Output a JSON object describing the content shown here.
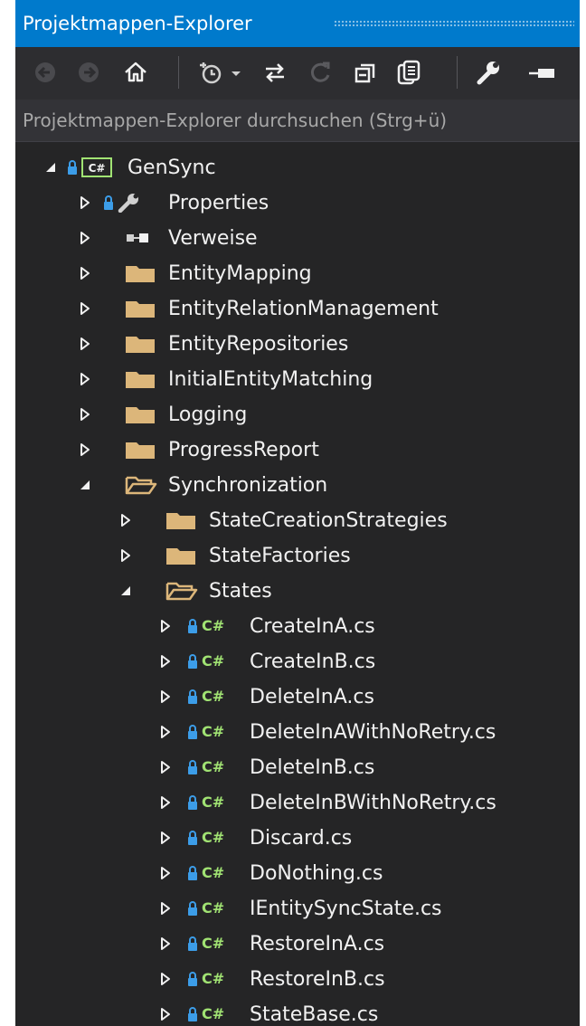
{
  "window": {
    "title": "Projektmappen-Explorer"
  },
  "search": {
    "placeholder": "Projektmappen-Explorer durchsuchen (Strg+ü)"
  },
  "toolbar": {
    "buttons": [
      "back-icon",
      "forward-icon",
      "home-icon",
      "history-icon",
      "dropdown-icon",
      "sync-icon",
      "refresh-icon",
      "collapse-all-icon",
      "show-all-files-icon",
      "properties-icon",
      "pin-icon"
    ]
  },
  "colors": {
    "title_bar": "#007acc",
    "panel": "#252526",
    "folder": "#dcb67a",
    "csharp": "#a1e373",
    "lock": "#3c9de8"
  },
  "tree": [
    {
      "label": "GenSync",
      "level": 0,
      "expanded": true,
      "icon": "csharp-project-icon"
    },
    {
      "label": "Properties",
      "level": 1,
      "expanded": false,
      "icon": "wrench-icon"
    },
    {
      "label": "Verweise",
      "level": 1,
      "expanded": false,
      "icon": "references-icon"
    },
    {
      "label": "EntityMapping",
      "level": 1,
      "expanded": false,
      "icon": "folder-icon"
    },
    {
      "label": "EntityRelationManagement",
      "level": 1,
      "expanded": false,
      "icon": "folder-icon"
    },
    {
      "label": "EntityRepositories",
      "level": 1,
      "expanded": false,
      "icon": "folder-icon"
    },
    {
      "label": "InitialEntityMatching",
      "level": 1,
      "expanded": false,
      "icon": "folder-icon"
    },
    {
      "label": "Logging",
      "level": 1,
      "expanded": false,
      "icon": "folder-icon"
    },
    {
      "label": "ProgressReport",
      "level": 1,
      "expanded": false,
      "icon": "folder-icon"
    },
    {
      "label": "Synchronization",
      "level": 1,
      "expanded": true,
      "icon": "folder-open-icon"
    },
    {
      "label": "StateCreationStrategies",
      "level": 2,
      "expanded": false,
      "icon": "folder-icon"
    },
    {
      "label": "StateFactories",
      "level": 2,
      "expanded": false,
      "icon": "folder-icon"
    },
    {
      "label": "States",
      "level": 2,
      "expanded": true,
      "icon": "folder-open-icon"
    },
    {
      "label": "CreateInA.cs",
      "level": 3,
      "expanded": false,
      "icon": "csharp-file-icon"
    },
    {
      "label": "CreateInB.cs",
      "level": 3,
      "expanded": false,
      "icon": "csharp-file-icon"
    },
    {
      "label": "DeleteInA.cs",
      "level": 3,
      "expanded": false,
      "icon": "csharp-file-icon"
    },
    {
      "label": "DeleteInAWithNoRetry.cs",
      "level": 3,
      "expanded": false,
      "icon": "csharp-file-icon"
    },
    {
      "label": "DeleteInB.cs",
      "level": 3,
      "expanded": false,
      "icon": "csharp-file-icon"
    },
    {
      "label": "DeleteInBWithNoRetry.cs",
      "level": 3,
      "expanded": false,
      "icon": "csharp-file-icon"
    },
    {
      "label": "Discard.cs",
      "level": 3,
      "expanded": false,
      "icon": "csharp-file-icon"
    },
    {
      "label": "DoNothing.cs",
      "level": 3,
      "expanded": false,
      "icon": "csharp-file-icon"
    },
    {
      "label": "IEntitySyncState.cs",
      "level": 3,
      "expanded": false,
      "icon": "csharp-file-icon"
    },
    {
      "label": "RestoreInA.cs",
      "level": 3,
      "expanded": false,
      "icon": "csharp-file-icon"
    },
    {
      "label": "RestoreInB.cs",
      "level": 3,
      "expanded": false,
      "icon": "csharp-file-icon"
    },
    {
      "label": "StateBase.cs",
      "level": 3,
      "expanded": false,
      "icon": "csharp-file-icon"
    }
  ]
}
